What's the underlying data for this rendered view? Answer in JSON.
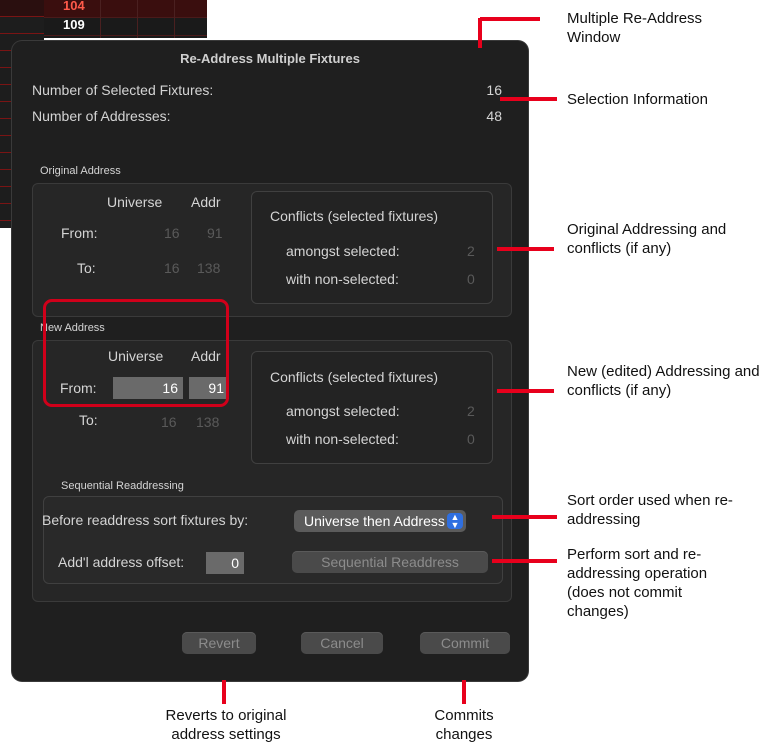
{
  "background_sheet": {
    "values": [
      "104",
      "109"
    ]
  },
  "dialog": {
    "title": "Re-Address Multiple Fixtures",
    "selection": {
      "fixtures_label": "Number of Selected Fixtures:",
      "fixtures_value": "16",
      "addresses_label": "Number of Addresses:",
      "addresses_value": "48"
    },
    "original": {
      "section_label": "Original Address",
      "col_universe": "Universe",
      "col_addr": "Addr",
      "from_label": "From:",
      "to_label": "To:",
      "from_universe": "16",
      "from_addr": "91",
      "to_universe": "16",
      "to_addr": "138",
      "conflicts_title": "Conflicts (selected fixtures)",
      "amongst_label": "amongst selected:",
      "amongst_value": "2",
      "nonselected_label": "with non-selected:",
      "nonselected_value": "0"
    },
    "new": {
      "section_label": "New Address",
      "col_universe": "Universe",
      "col_addr": "Addr",
      "from_label": "From:",
      "to_label": "To:",
      "from_universe": "16",
      "from_addr": "91",
      "to_universe": "16",
      "to_addr": "138",
      "conflicts_title": "Conflicts (selected fixtures)",
      "amongst_label": "amongst selected:",
      "amongst_value": "2",
      "nonselected_label": "with non-selected:",
      "nonselected_value": "0"
    },
    "sequential": {
      "section_label": "Sequential Readdressing",
      "sort_label": "Before readdress sort fixtures by:",
      "sort_value": "Universe then Address",
      "offset_label": "Add'l address offset:",
      "offset_value": "0",
      "readdress_button": "Sequential Readdress"
    },
    "buttons": {
      "revert": "Revert",
      "cancel": "Cancel",
      "commit": "Commit"
    }
  },
  "callouts": {
    "window": "Multiple Re-Address Window",
    "selection": "Selection Information",
    "original": "Original Addressing and conflicts (if any)",
    "new": "New (edited) Addressing and conflicts (if any)",
    "sort": "Sort order used when re-addressing",
    "perform": "Perform sort and re-addressing operation (does not commit changes)",
    "revert": "Reverts to original address settings",
    "commit": "Commits changes"
  },
  "colors": {
    "callout_line": "#e8001c",
    "dialog_bg": "#1f1f1f",
    "accent_blue": "#2f6fe0"
  }
}
